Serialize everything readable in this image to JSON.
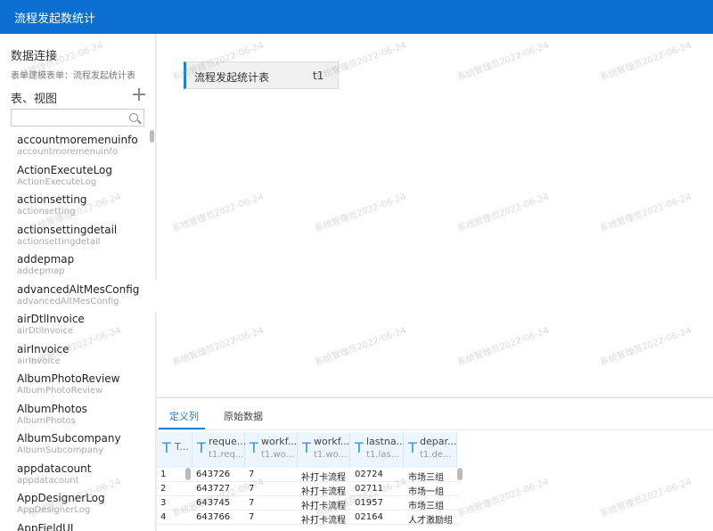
{
  "header": {
    "title": "流程发起数统计"
  },
  "sidebar": {
    "data_connection_title": "数据连接",
    "form_subtitle": "表单建模表单：流程发起统计表",
    "tables_title": "表、视图",
    "search": {
      "value": "",
      "placeholder": ""
    },
    "tables": [
      {
        "name": "accountmoremenuinfo",
        "sub": "accountmoremenuinfo"
      },
      {
        "name": "ActionExecuteLog",
        "sub": "ActionExecuteLog"
      },
      {
        "name": "actionsetting",
        "sub": "actionsetting"
      },
      {
        "name": "actionsettingdetail",
        "sub": "actionsettingdetail"
      },
      {
        "name": "addepmap",
        "sub": "addepmap"
      },
      {
        "name": "advancedAltMesConfig",
        "sub": "advancedAltMesConfig"
      },
      {
        "name": "airDtlInvoice",
        "sub": "airDtlInvoice"
      },
      {
        "name": "airInvoice",
        "sub": "airInvoice"
      },
      {
        "name": "AlbumPhotoReview",
        "sub": "AlbumPhotoReview"
      },
      {
        "name": "AlbumPhotos",
        "sub": "AlbumPhotos"
      },
      {
        "name": "AlbumSubcompany",
        "sub": "AlbumSubcompany"
      },
      {
        "name": "appdatacount",
        "sub": "appdatacount"
      },
      {
        "name": "AppDesignerLog",
        "sub": "AppDesignerLog"
      },
      {
        "name": "AppFieldUI",
        "sub": ""
      }
    ]
  },
  "canvas": {
    "node": {
      "name": "流程发起统计表",
      "alias": "t1"
    }
  },
  "bottom": {
    "tabs": [
      {
        "label": "定义列",
        "active": true
      },
      {
        "label": "原始数据",
        "active": false
      }
    ],
    "columns": [
      {
        "name": "T...",
        "sub": ""
      },
      {
        "name": "reque...",
        "sub": "t1.req..."
      },
      {
        "name": "workf...",
        "sub": "t1.wo..."
      },
      {
        "name": "workf...",
        "sub": "t1.wo..."
      },
      {
        "name": "lastna...",
        "sub": "t1.las..."
      },
      {
        "name": "depar...",
        "sub": "t1.de..."
      }
    ],
    "rows": [
      [
        "1",
        "643726",
        "7",
        "补打卡流程",
        "02724",
        "市场三组"
      ],
      [
        "2",
        "643727",
        "7",
        "补打卡流程",
        "02711",
        "市场一组"
      ],
      [
        "3",
        "643745",
        "7",
        "补打卡流程",
        "01957",
        "市场三组"
      ],
      [
        "4",
        "643766",
        "7",
        "补打卡流程",
        "02164",
        "人才激励组"
      ]
    ]
  },
  "watermark": {
    "text": "系统管理员2022-06-24"
  }
}
